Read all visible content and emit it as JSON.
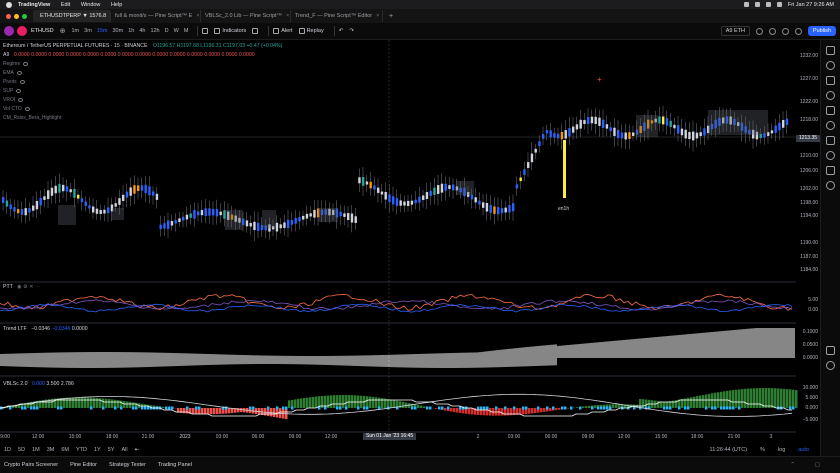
{
  "macos": {
    "menu": [
      "TradingView",
      "Edit",
      "Window",
      "Help"
    ],
    "clock": "Fri Jan 27  9:26 AM"
  },
  "tabs": [
    {
      "label": "ETHUSDTPERP ▼ 1576.8",
      "active": true
    },
    {
      "label": "full & monit/s — Pine Script™ E",
      "active": false
    },
    {
      "label": "VBLSc_2.0 Lib — Pine Script™",
      "active": false
    },
    {
      "label": "Trend_F — Pine Script™ Editor",
      "active": false
    }
  ],
  "toolbar": {
    "symbol": "ETHUSD",
    "intervals": [
      "1m",
      "3m",
      "15m",
      "30m",
      "1h",
      "4h",
      "12h",
      "D",
      "W",
      "M"
    ],
    "selected_interval": "15m",
    "indicators_label": "Indicators",
    "alert_label": "Alert",
    "replay_label": "Replay",
    "layout_label": "A9 ETH",
    "publish_label": "Publish"
  },
  "legend": {
    "title": "Ethereum / TetherUS PERPETUAL FUTURES · 15 · BINANCE",
    "ohlc": "O1196.57 H1197.68 L1196.31 C1197.03 +0.47 (+0.04%)",
    "a9_label": "A9",
    "a9_values": "0.0000  0.0000  0.0000  0.0000  0.0000  0.0000  0.0000  0.0000  0.0000  0.0000  0.0000  0.0000  0.0000  0.0000",
    "indicators": [
      "Regime",
      "EMA",
      "Pivots",
      "SUP",
      "VROI",
      "Vol  CTO",
      "CM_Rsiss_Bera_Highlight"
    ]
  },
  "panes": {
    "ptt_label": "PTT",
    "trend_label": "Trend LTF",
    "trend_v1": "−0.0346",
    "trend_v2": "−0.0346",
    "trend_v3": "0.0000",
    "vbls_label": "VBLSc 2.0",
    "vbls_v1": "0.000",
    "vbls_v2": "3.500",
    "vbls_v3": "2.786"
  },
  "price_axis": {
    "main": [
      "1232.00",
      "1227.00",
      "1222.00",
      "1218.00",
      "1210.00",
      "1206.00",
      "1202.00",
      "1198.00",
      "1194.00",
      "1190.00",
      "1187.00",
      "1184.00"
    ],
    "last_price": "1213.35",
    "ptt": [
      "5.00",
      "0.00"
    ],
    "trend": [
      "0.1000",
      "0.0500",
      "0.0000"
    ],
    "vbls": [
      "10.000",
      "5.000",
      "0.000",
      "−5.000"
    ]
  },
  "time_axis": {
    "labels": [
      "9:00",
      "12:00",
      "15:00",
      "18:00",
      "21:00",
      "2023",
      "03:00",
      "06:00",
      "09:00",
      "12:00",
      "Sun 01 Jan '23  16:45",
      "2",
      "03:00",
      "06:00",
      "09:00",
      "12:00",
      "15:00",
      "18:00",
      "21:00",
      "3"
    ],
    "crosshair": "Sun 01 Jan '23  16:45"
  },
  "rangebar": {
    "ranges": [
      "1D",
      "5D",
      "1M",
      "3M",
      "6M",
      "YTD",
      "1Y",
      "5Y",
      "All"
    ],
    "clock": "11:26:44 (UTC)",
    "pct": "%",
    "log": "log",
    "auto": "auto"
  },
  "bottombar": {
    "items": [
      "Crypto Pairs Screener",
      "Pine Editor",
      "Strategy Tester",
      "Trading Panel"
    ]
  },
  "annotation": "en1h"
}
